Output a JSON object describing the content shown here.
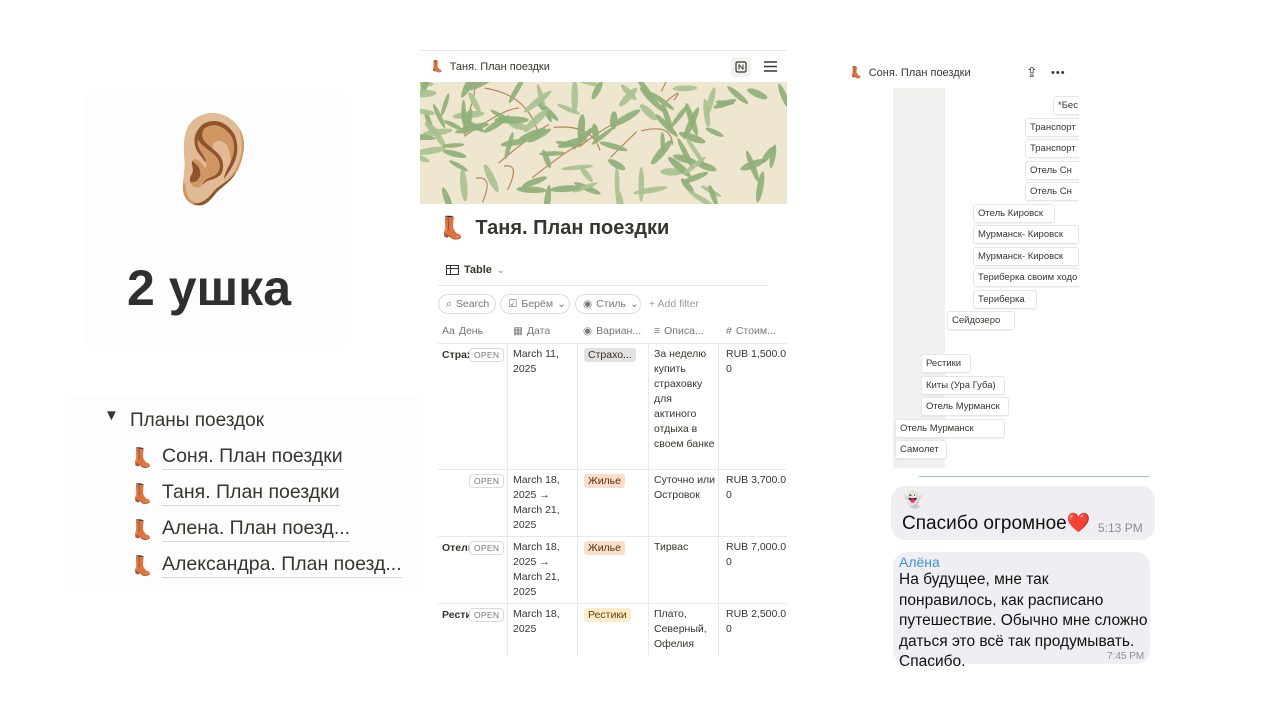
{
  "ear_card": {
    "emoji": "👂🏼",
    "title": "2 ушка"
  },
  "plans": {
    "toggle_icon": "▼",
    "title": "Планы поездок",
    "icon": "👢",
    "items": [
      "Соня. План поездки",
      "Таня. План поездки",
      "Алена. План поезд...",
      "Александра. План поезд..."
    ]
  },
  "notion": {
    "breadcrumb": "Таня. План поездки",
    "page_icon": "👢",
    "page_title": "Таня. План поездки",
    "view_label": "Table",
    "search_label": "Search",
    "filter_take": "Берём",
    "filter_style": "Стиль",
    "add_filter": "Add filter",
    "columns": [
      "День",
      "Дата",
      "Вариан...",
      "Описа...",
      "Стоим..."
    ],
    "column_icons": [
      "Aa",
      "▦",
      "◉",
      "≡",
      "#"
    ],
    "open_label": "OPEN",
    "rows": [
      {
        "day": "Страх",
        "date": "March 11, 2025",
        "tag": "Страхо...",
        "desc": "За неделю купить страховку для актиного отдыха в своем банке",
        "cost": "RUB 1,500.00"
      },
      {
        "day": "",
        "date": "March 18, 2025 → March 21, 2025",
        "tag": "Жилье",
        "desc": "Суточно или Островок",
        "cost": "RUB 3,700.00"
      },
      {
        "day": "Отель",
        "date": "March 18, 2025 → March 21, 2025",
        "tag": "Жилье",
        "desc": "Тирвас",
        "cost": "RUB 7,000.00"
      },
      {
        "day": "Рести",
        "date": "March 18, 2025",
        "tag": "Рестики",
        "desc": "Плато, Северный, Офелия",
        "cost": "RUB 2,500.00"
      }
    ],
    "colors": {
      "cover_bg": "#efe6cf",
      "leaf": "#8fb07a"
    }
  },
  "graph": {
    "breadcrumb": "Соня. План поездки",
    "icon": "👢",
    "share_icon": "⇪",
    "more_icon": "•••",
    "cards": [
      "*Бес",
      "Транспорт",
      "Транспорт",
      "Отель Сн",
      "Отель Сн",
      "Отель Кировск",
      "Мурманск- Кировск",
      "Мурманск- Кировск",
      "Териберка своим ходо",
      "Териберка",
      "Сейдозеро",
      "Рестики",
      "Киты (Ура Губа)",
      "Отель Мурманск",
      "Отель Мурманск",
      "Самолет"
    ]
  },
  "chat": {
    "msg1_emoji": "👻",
    "msg1_text": "Спасибо огромное❤️",
    "msg1_time": "5:13 PM",
    "msg2_author": "Алёна",
    "msg2_text": "На будущее, мне так понравилось, как расписано путешествие. Обычно мне сложно даться это всё так продумывать. Спасибо.",
    "msg2_time": "7:45 PM"
  }
}
